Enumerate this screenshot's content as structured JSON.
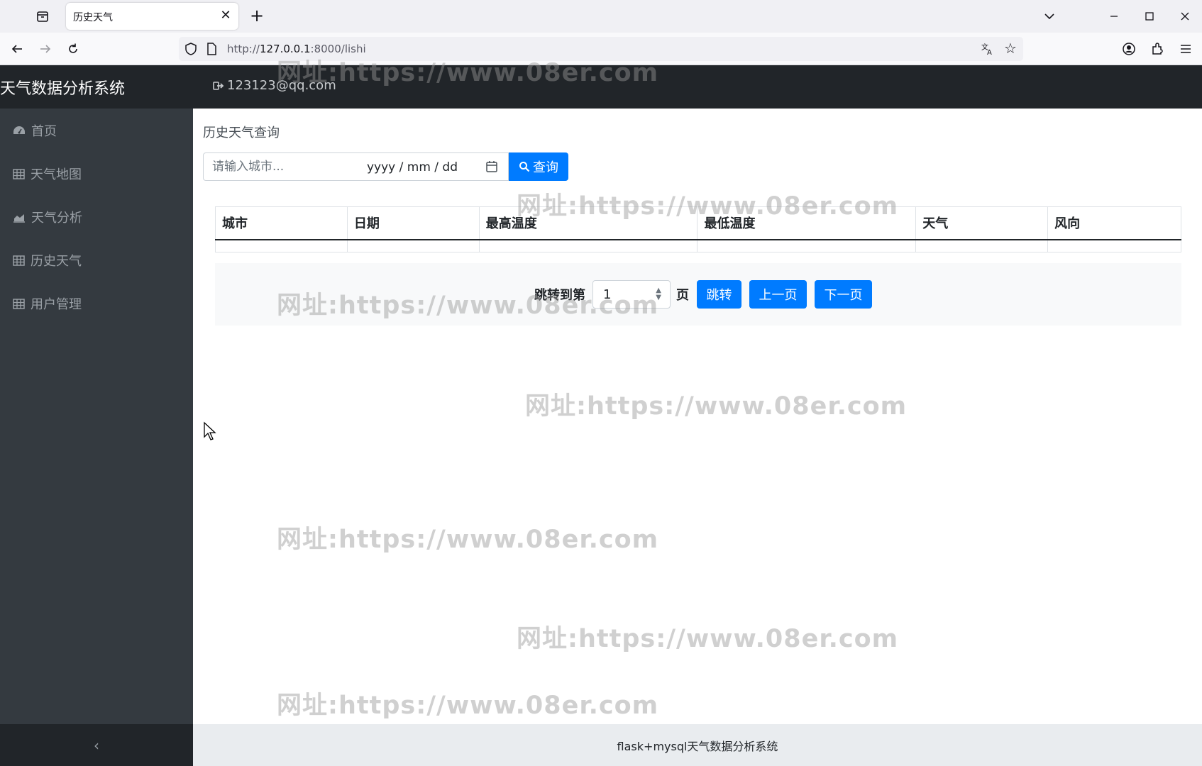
{
  "browser": {
    "tab_title": "历史天气",
    "tab_close": "✕",
    "new_tab": "+",
    "url_scheme": "http://",
    "url_host": "127.0.0.1",
    "url_rest": ":8000/lishi"
  },
  "header": {
    "brand": "天气数据分析系统",
    "user_email": "123123@qq.com"
  },
  "sidebar": {
    "items": [
      {
        "label": "首页",
        "icon": "dashboard-icon"
      },
      {
        "label": "天气地图",
        "icon": "table-icon"
      },
      {
        "label": "天气分析",
        "icon": "area-chart-icon"
      },
      {
        "label": "历史天气",
        "icon": "table-icon"
      },
      {
        "label": "用户管理",
        "icon": "table-icon"
      }
    ],
    "collapse": "‹"
  },
  "main": {
    "title": "历史天气查询",
    "search_placeholder": "请输入城市...",
    "date_placeholder": "yyyy / mm / dd",
    "query_label": "查询",
    "table": {
      "columns": [
        "城市",
        "日期",
        "最高温度",
        "最低温度",
        "天气",
        "风向"
      ]
    },
    "pager": {
      "prefix": "跳转到第",
      "page_value": "1",
      "suffix": "页",
      "jump": "跳转",
      "prev": "上一页",
      "next": "下一页"
    }
  },
  "footer": {
    "text": "flask+mysql天气数据分析系统"
  },
  "watermark": "网址:https://www.08er.com",
  "colors": {
    "primary": "#007bff",
    "header_bg": "#212529",
    "sidebar_bg": "#343a40"
  }
}
